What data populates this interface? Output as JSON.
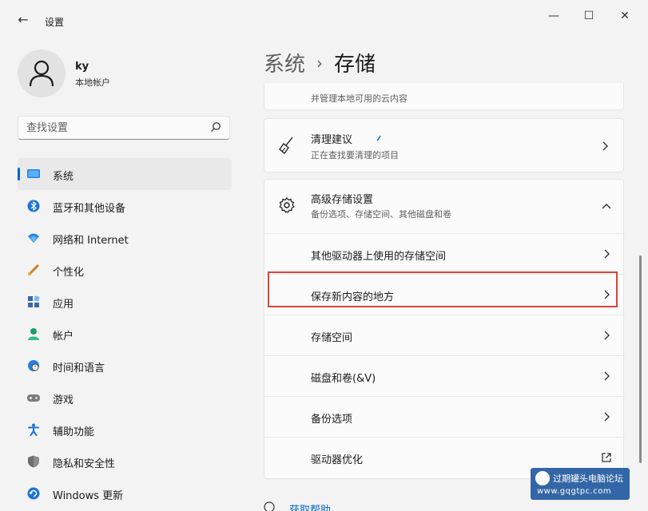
{
  "window": {
    "title": "设置",
    "back_glyph": "←",
    "min_glyph": "—",
    "max_glyph": "☐",
    "close_glyph": "✕"
  },
  "user": {
    "name": "ky",
    "account_type": "本地帐户"
  },
  "search": {
    "placeholder": "查找设置",
    "icon": "search-icon"
  },
  "nav": {
    "items": [
      {
        "label": "系统",
        "icon": "display-icon",
        "active": true
      },
      {
        "label": "蓝牙和其他设备",
        "icon": "bluetooth-icon"
      },
      {
        "label": "网络和 Internet",
        "icon": "wifi-icon"
      },
      {
        "label": "个性化",
        "icon": "brush-icon"
      },
      {
        "label": "应用",
        "icon": "apps-icon"
      },
      {
        "label": "帐户",
        "icon": "person-icon"
      },
      {
        "label": "时间和语言",
        "icon": "globe-clock-icon"
      },
      {
        "label": "游戏",
        "icon": "gamepad-icon"
      },
      {
        "label": "辅助功能",
        "icon": "accessibility-icon"
      },
      {
        "label": "隐私和安全性",
        "icon": "shield-icon"
      },
      {
        "label": "Windows 更新",
        "icon": "update-icon"
      }
    ]
  },
  "breadcrumb": {
    "parent": "系统",
    "separator": "›",
    "current": "存储"
  },
  "cards": {
    "cloud": {
      "subtitle": "并管理本地可用的云内容"
    },
    "cleanup": {
      "title": "清理建议",
      "subtitle": "正在查找要清理的项目",
      "icon": "broom-icon"
    },
    "advanced": {
      "title": "高级存储设置",
      "subtitle": "备份选项、存储空间、其他磁盘和卷",
      "icon": "gear-icon",
      "expanded": true,
      "rows": [
        {
          "label": "其他驱动器上使用的存储空间"
        },
        {
          "label": "保存新内容的地方",
          "highlighted": true
        },
        {
          "label": "存储空间"
        },
        {
          "label": "磁盘和卷(&V)"
        },
        {
          "label": "备份选项"
        },
        {
          "label": "驱动器优化",
          "external": true
        }
      ]
    }
  },
  "footer": {
    "help_link": "获取帮助"
  },
  "watermark": {
    "name": "过期罐头电脑论坛",
    "url": "www.gqgtpc.com"
  },
  "colors": {
    "accent": "#0067c0",
    "highlight_border": "#d9433b",
    "window_bg": "#f3f3f3",
    "card_bg": "#fbfbfb"
  }
}
